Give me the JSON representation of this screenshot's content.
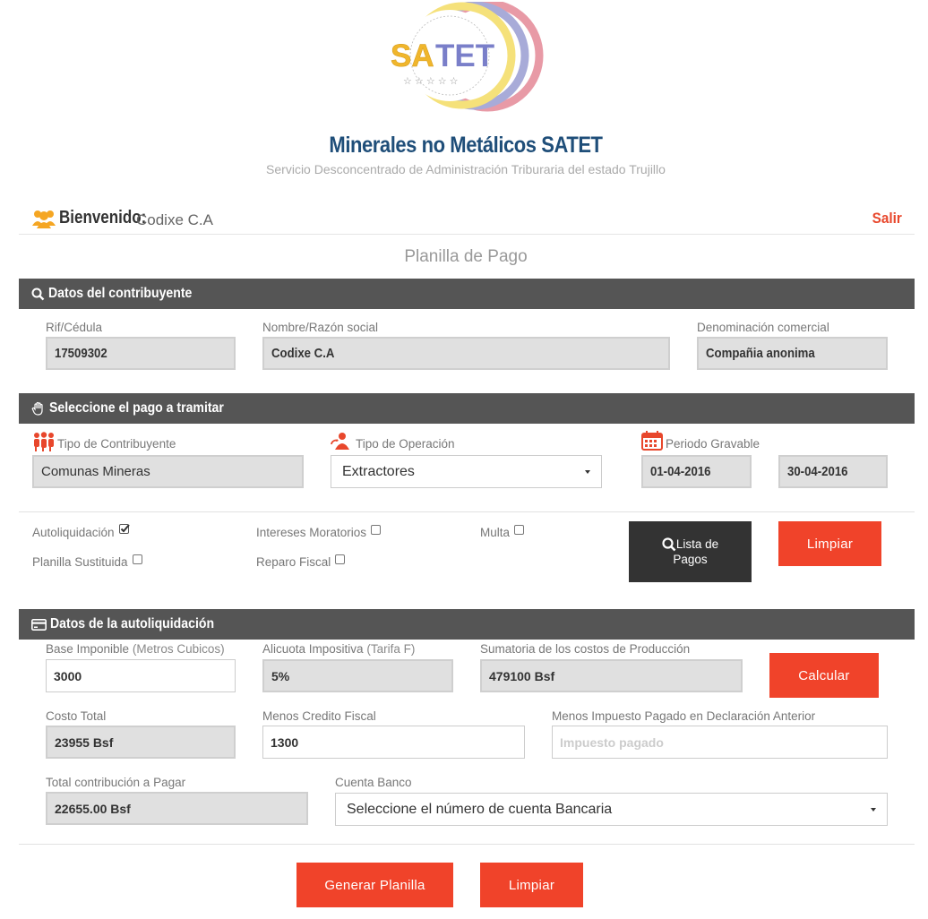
{
  "header": {
    "logo_text": "SATET",
    "title": "Minerales no Metálicos SATET",
    "subtitle": "Servicio Desconcentrado de Administración Triburaria del estado Trujillo"
  },
  "welcome": {
    "label": "Bienvenido:",
    "user": "Codixe C.A",
    "logout": "Salir"
  },
  "page_heading": "Planilla de Pago",
  "contribuyente": {
    "section_title": "Datos del contribuyente",
    "rif_label": "Rif/Cédula",
    "rif_value": "17509302",
    "nombre_label": "Nombre/Razón social",
    "nombre_value": "Codixe C.A",
    "denom_label": "Denominación comercial",
    "denom_value": "Compañia anonima"
  },
  "pago": {
    "section_title": "Seleccione el pago a tramitar",
    "tipo_contrib_label": "Tipo de Contribuyente",
    "tipo_contrib_value": "Comunas Mineras",
    "tipo_oper_label": "Tipo de Operación",
    "tipo_oper_value": "Extractores",
    "periodo_label": "Periodo Gravable",
    "periodo_desde": "01-04-2016",
    "periodo_hasta": "30-04-2016",
    "options": {
      "autoliquidacion": "Autoliquidación",
      "intereses": "Intereses Moratorios",
      "multa": "Multa",
      "sustituida": "Planilla Sustituida",
      "reparo": "Reparo Fiscal"
    },
    "lista_button_line1": "Lista de",
    "lista_button_line2": "Pagos",
    "limpiar_button": "Limpiar"
  },
  "autoliquidacion": {
    "section_title": "Datos de la autoliquidación",
    "base_label": "Base Imponible",
    "base_sub": "(Metros Cubicos)",
    "base_value": "3000",
    "alicuota_label": "Alicuota Impositiva",
    "alicuota_sub": "(Tarifa F)",
    "alicuota_value": "5%",
    "sumatoria_label": "Sumatoria de los costos de Producción",
    "sumatoria_value": "479100 Bsf",
    "calcular_button": "Calcular",
    "costo_label": "Costo Total",
    "costo_value": "23955 Bsf",
    "credito_label": "Menos Credito Fiscal",
    "credito_value": "1300",
    "impuesto_label": "Menos Impuesto Pagado en Declaración Anterior",
    "impuesto_placeholder": "Impuesto pagado",
    "total_label": "Total contribución a Pagar",
    "total_value": "22655.00 Bsf",
    "cuenta_label": "Cuenta Banco",
    "cuenta_value": "Seleccione el número de cuenta Bancaria"
  },
  "footer": {
    "generar_button": "Generar Planilla",
    "limpiar_button": "Limpiar"
  },
  "colors": {
    "accent": "#f0432a",
    "section_bar": "#555555",
    "title_blue": "#1f4e79"
  }
}
